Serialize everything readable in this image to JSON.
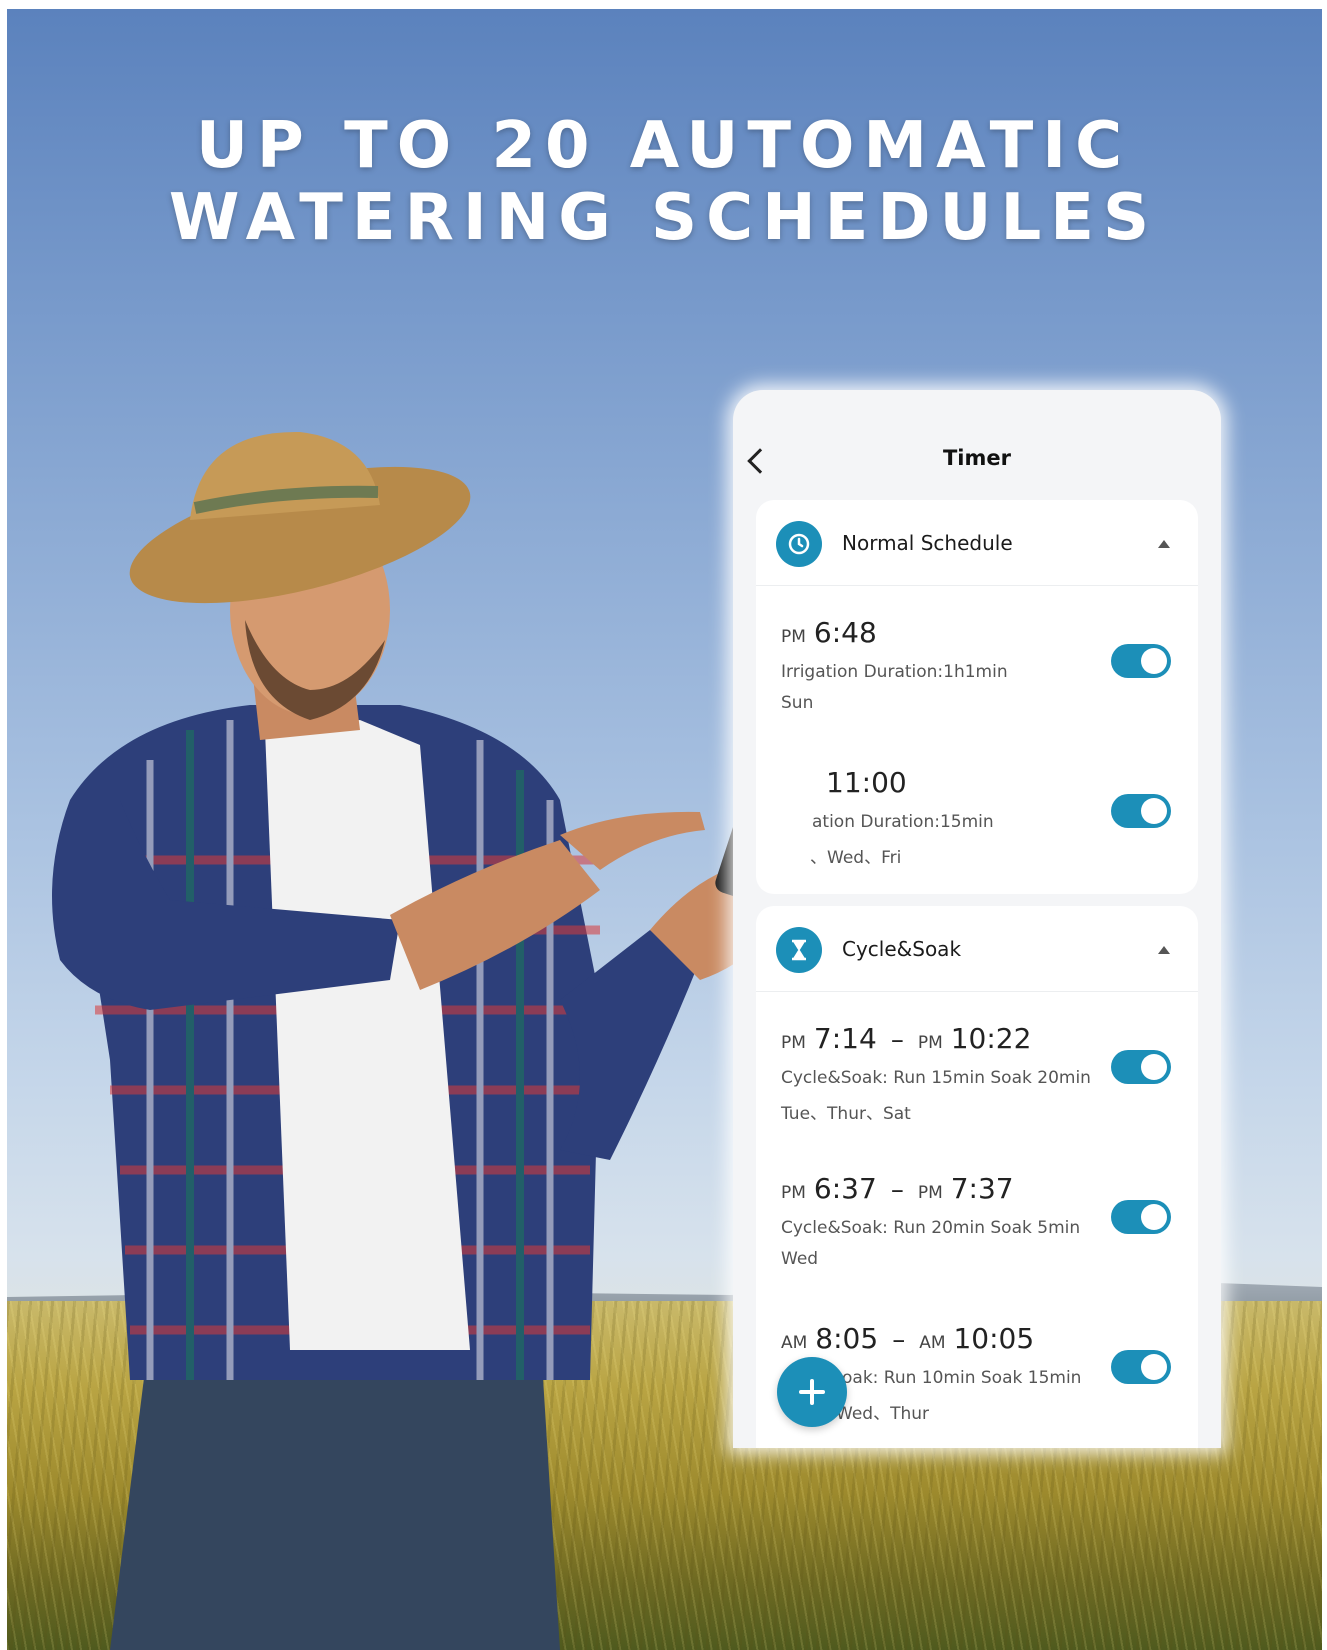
{
  "headline": {
    "line1": "UP TO 20 AUTOMATIC",
    "line2": "WATERING SCHEDULES"
  },
  "app": {
    "title": "Timer",
    "back_icon": "chevron-left-icon",
    "accent_color": "#1c8fb8",
    "add_button_icon": "plus-icon"
  },
  "sections": [
    {
      "title": "Normal Schedule",
      "icon": "clock-icon",
      "expanded": true,
      "items": [
        {
          "start_ampm": "PM",
          "start": "6:48",
          "detail": "Irrigation Duration:1h1min",
          "days": "Sun",
          "enabled": true
        },
        {
          "start_ampm": "",
          "start": "11:00",
          "detail": "ation Duration:15min",
          "days": "、Wed、Fri",
          "enabled": true
        }
      ]
    },
    {
      "title": "Cycle&Soak",
      "icon": "hourglass-icon",
      "expanded": true,
      "items": [
        {
          "start_ampm": "PM",
          "start": "7:14",
          "end_ampm": "PM",
          "end": "10:22",
          "detail": "Cycle&Soak: Run 15min Soak 20min",
          "days": "Tue、Thur、Sat",
          "enabled": true
        },
        {
          "start_ampm": "PM",
          "start": "6:37",
          "end_ampm": "PM",
          "end": "7:37",
          "detail": "Cycle&Soak: Run 20min Soak 5min",
          "days": "Wed",
          "enabled": true
        },
        {
          "start_ampm": "AM",
          "start": "8:05",
          "end_ampm": "AM",
          "end": "10:05",
          "detail": "oak: Run 10min Soak 15min",
          "days": "Wed、Thur",
          "enabled": true
        }
      ]
    }
  ]
}
